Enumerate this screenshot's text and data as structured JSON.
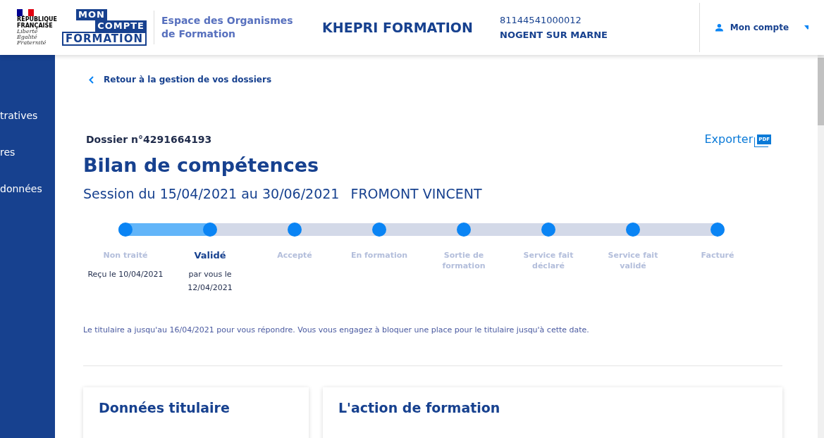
{
  "header": {
    "republique": {
      "name_lines": [
        "RÉPUBLIQUE",
        "FRANÇAISE"
      ],
      "motto_lines": [
        "Liberté",
        "Égalité",
        "Fraternité"
      ]
    },
    "logo_lines": [
      "MON",
      "COMPTE",
      "FORMATION"
    ],
    "space_title": "Espace des Organismes de Formation",
    "organism": "KHEPRI FORMATION",
    "siret": "81144541000012",
    "city": "NOGENT SUR MARNE",
    "account": {
      "label": "Mon compte"
    }
  },
  "sidebar": {
    "items": [
      {
        "label": "tratives"
      },
      {
        "label": "res"
      },
      {
        "label": "données"
      }
    ]
  },
  "back_link": "Retour à la gestion de vos dossiers",
  "dossier": {
    "number": "Dossier n°4291664193",
    "export": {
      "label": "Exporter",
      "icon_text": "PDF"
    },
    "title": "Bilan de compétences",
    "session": "Session du 15/04/2021 au 30/06/2021",
    "holder": "FROMONT VINCENT"
  },
  "progress": {
    "level": 0.143,
    "steps": [
      {
        "label": "Non traité",
        "selected": false,
        "detail": "Reçu le 10/04/2021"
      },
      {
        "label": "Validé",
        "selected": true,
        "detail": "par vous le 12/04/2021"
      },
      {
        "label": "Accepté",
        "selected": false
      },
      {
        "label": "En formation",
        "selected": false
      },
      {
        "label": "Sortie de formation",
        "selected": false
      },
      {
        "label": "Service fait déclaré",
        "selected": false
      },
      {
        "label": "Service fait validé",
        "selected": false
      },
      {
        "label": "Facturé",
        "selected": false
      }
    ]
  },
  "notice": "Le titulaire a jusqu'au 16/04/2021 pour vous répondre. Vous vous engagez à bloquer une place pour le titulaire jusqu'à cette date.",
  "cards": [
    {
      "title": "Données titulaire"
    },
    {
      "title": "L'action de formation"
    }
  ]
}
